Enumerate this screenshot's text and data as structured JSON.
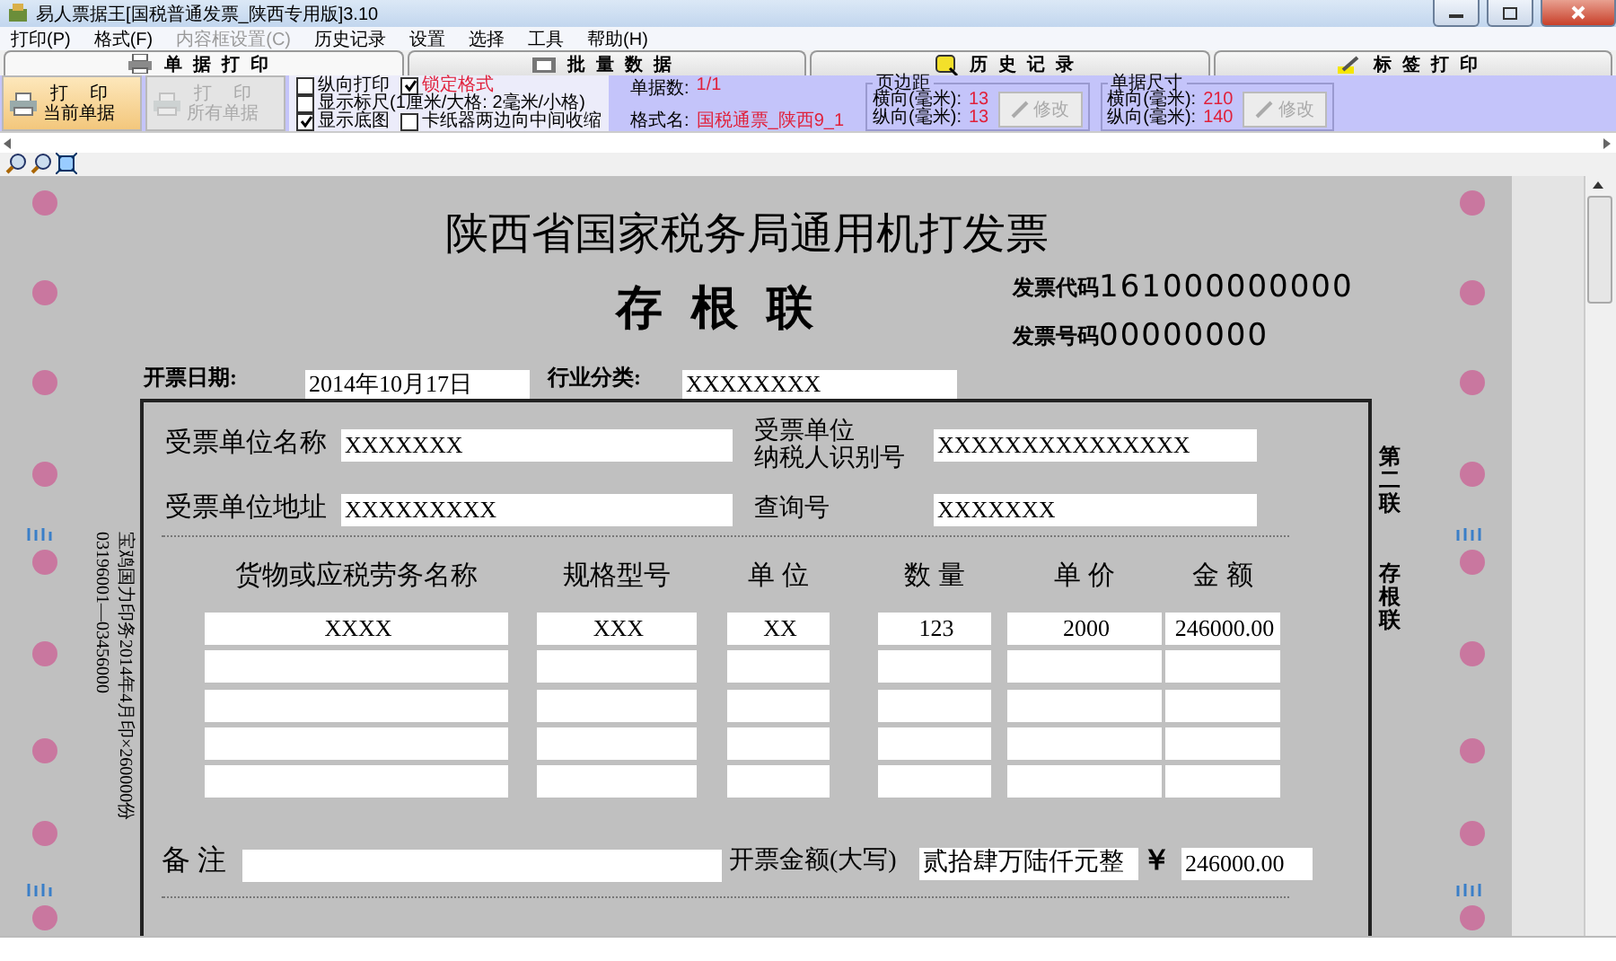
{
  "window": {
    "title": "易人票据王[国税普通发票_陕西专用版]3.10"
  },
  "menu": [
    {
      "label": "打印(P)",
      "disabled": false
    },
    {
      "label": "格式(F)",
      "disabled": false
    },
    {
      "label": "内容框设置(C)",
      "disabled": true
    },
    {
      "label": "历史记录",
      "disabled": false
    },
    {
      "label": "设置",
      "disabled": false
    },
    {
      "label": "选择",
      "disabled": false
    },
    {
      "label": "工具",
      "disabled": false
    },
    {
      "label": "帮助(H)",
      "disabled": false
    }
  ],
  "tabs": [
    {
      "label": "单据打印",
      "kind": "printer",
      "selected": true
    },
    {
      "label": "批量数据",
      "kind": "folder",
      "selected": false
    },
    {
      "label": "历史记录",
      "kind": "database",
      "selected": false
    },
    {
      "label": "标签打印",
      "kind": "pen",
      "selected": false
    }
  ],
  "toolbar": {
    "buttons": [
      {
        "title": "打印",
        "subtitle": "当前单据",
        "disabled": false
      },
      {
        "title": "打印",
        "subtitle": "所有单据",
        "disabled": true
      }
    ],
    "checkboxes": [
      {
        "label": "纵向打印",
        "checked": false,
        "emphasis": false
      },
      {
        "label": "锁定格式",
        "checked": true,
        "emphasis": true
      },
      {
        "label": "显示标尺(1厘米/大格: 2毫米/小格)",
        "checked": false,
        "emphasis": false
      },
      {
        "label": "显示底图",
        "checked": true,
        "emphasis": false
      },
      {
        "label": "卡纸器两边向中间收缩",
        "checked": false,
        "emphasis": false
      }
    ],
    "info": {
      "count_label": "单据数:",
      "count": "1/1",
      "format_label": "格式名:",
      "format": "国税通票_陕西9_1"
    },
    "groups": [
      {
        "title": "页边距",
        "rows": [
          {
            "label": "横向(毫米):",
            "value": "13"
          },
          {
            "label": "纵向(毫米):",
            "value": "13"
          }
        ],
        "button": "修改",
        "button_disabled": true
      },
      {
        "title": "单据尺寸",
        "rows": [
          {
            "label": "横向(毫米):",
            "value": "210"
          },
          {
            "label": "纵向(毫米):",
            "value": "140"
          }
        ],
        "button": "修改",
        "button_disabled": true
      }
    ]
  },
  "invoice": {
    "title": "陕西省国家税务局通用机打发票",
    "subtitle": "存根联",
    "code_label": "发票代码",
    "code": "161000000000",
    "number_label": "发票号码",
    "number": "00000000",
    "date_label": "开票日期:",
    "date": "2014年10月17日",
    "industry_label": "行业分类:",
    "industry": "XXXXXXXX",
    "buyer_name_label": "受票单位名称",
    "buyer_name": "XXXXXXX",
    "buyer_tax_label": [
      "受票单位",
      "纳税人识别号"
    ],
    "buyer_tax": "XXXXXXXXXXXXXXX",
    "buyer_address_label": "受票单位地址",
    "buyer_address": "XXXXXXXXX",
    "query_label": "查询号",
    "query": "XXXXXXX",
    "columns": [
      "货物或应税劳务名称",
      "规格型号",
      "单 位",
      "数 量",
      "单 价",
      "金 额"
    ],
    "rows": [
      [
        "XXXX",
        "XXX",
        "XX",
        "123",
        "2000",
        "246000.00"
      ]
    ],
    "remark_label": "备 注",
    "total_words_label": "开票金额(大写)",
    "total_words": "贰拾肆万陆仟元整",
    "yen": "￥",
    "total": "246000.00",
    "printer_note": [
      "宝鸡国力印务2014年4月印×260000份",
      "03196001—03456000"
    ],
    "copy_label": "第二联",
    "copy_name": "存根联"
  }
}
